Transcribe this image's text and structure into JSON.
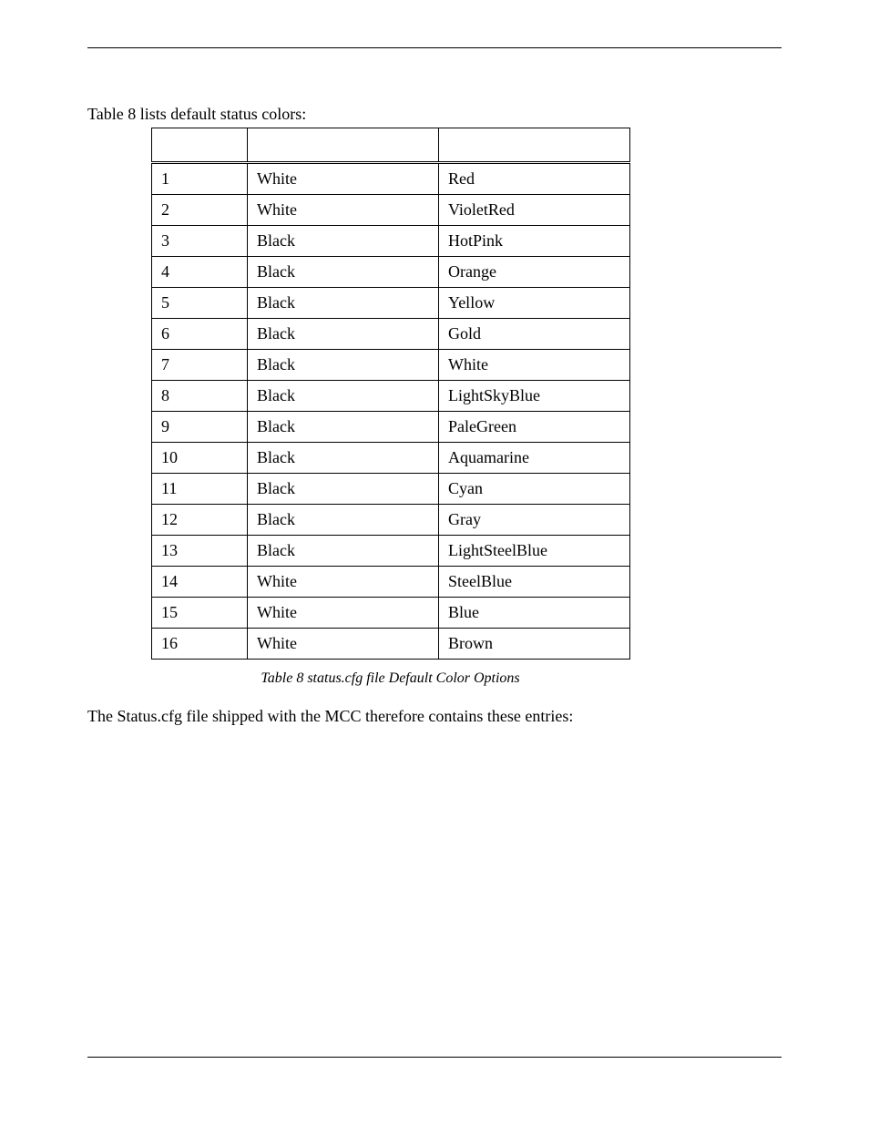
{
  "intro": "Table 8 lists default status colors:",
  "caption": "Table 8 status.cfg file Default Color Options",
  "outro": "The Status.cfg file shipped with the MCC therefore contains these entries:",
  "table": {
    "headers": [
      "",
      "",
      ""
    ],
    "rows": [
      {
        "n": "1",
        "fg": "White",
        "bg": "Red"
      },
      {
        "n": "2",
        "fg": "White",
        "bg": "VioletRed"
      },
      {
        "n": "3",
        "fg": "Black",
        "bg": "HotPink"
      },
      {
        "n": "4",
        "fg": "Black",
        "bg": "Orange"
      },
      {
        "n": "5",
        "fg": "Black",
        "bg": "Yellow"
      },
      {
        "n": "6",
        "fg": "Black",
        "bg": "Gold"
      },
      {
        "n": "7",
        "fg": "Black",
        "bg": "White"
      },
      {
        "n": "8",
        "fg": "Black",
        "bg": "LightSkyBlue"
      },
      {
        "n": "9",
        "fg": "Black",
        "bg": "PaleGreen"
      },
      {
        "n": "10",
        "fg": "Black",
        "bg": "Aquamarine"
      },
      {
        "n": "11",
        "fg": "Black",
        "bg": "Cyan"
      },
      {
        "n": "12",
        "fg": "Black",
        "bg": "Gray"
      },
      {
        "n": "13",
        "fg": "Black",
        "bg": "LightSteelBlue"
      },
      {
        "n": "14",
        "fg": "White",
        "bg": "SteelBlue"
      },
      {
        "n": "15",
        "fg": "White",
        "bg": "Blue"
      },
      {
        "n": "16",
        "fg": "White",
        "bg": "Brown"
      }
    ]
  }
}
